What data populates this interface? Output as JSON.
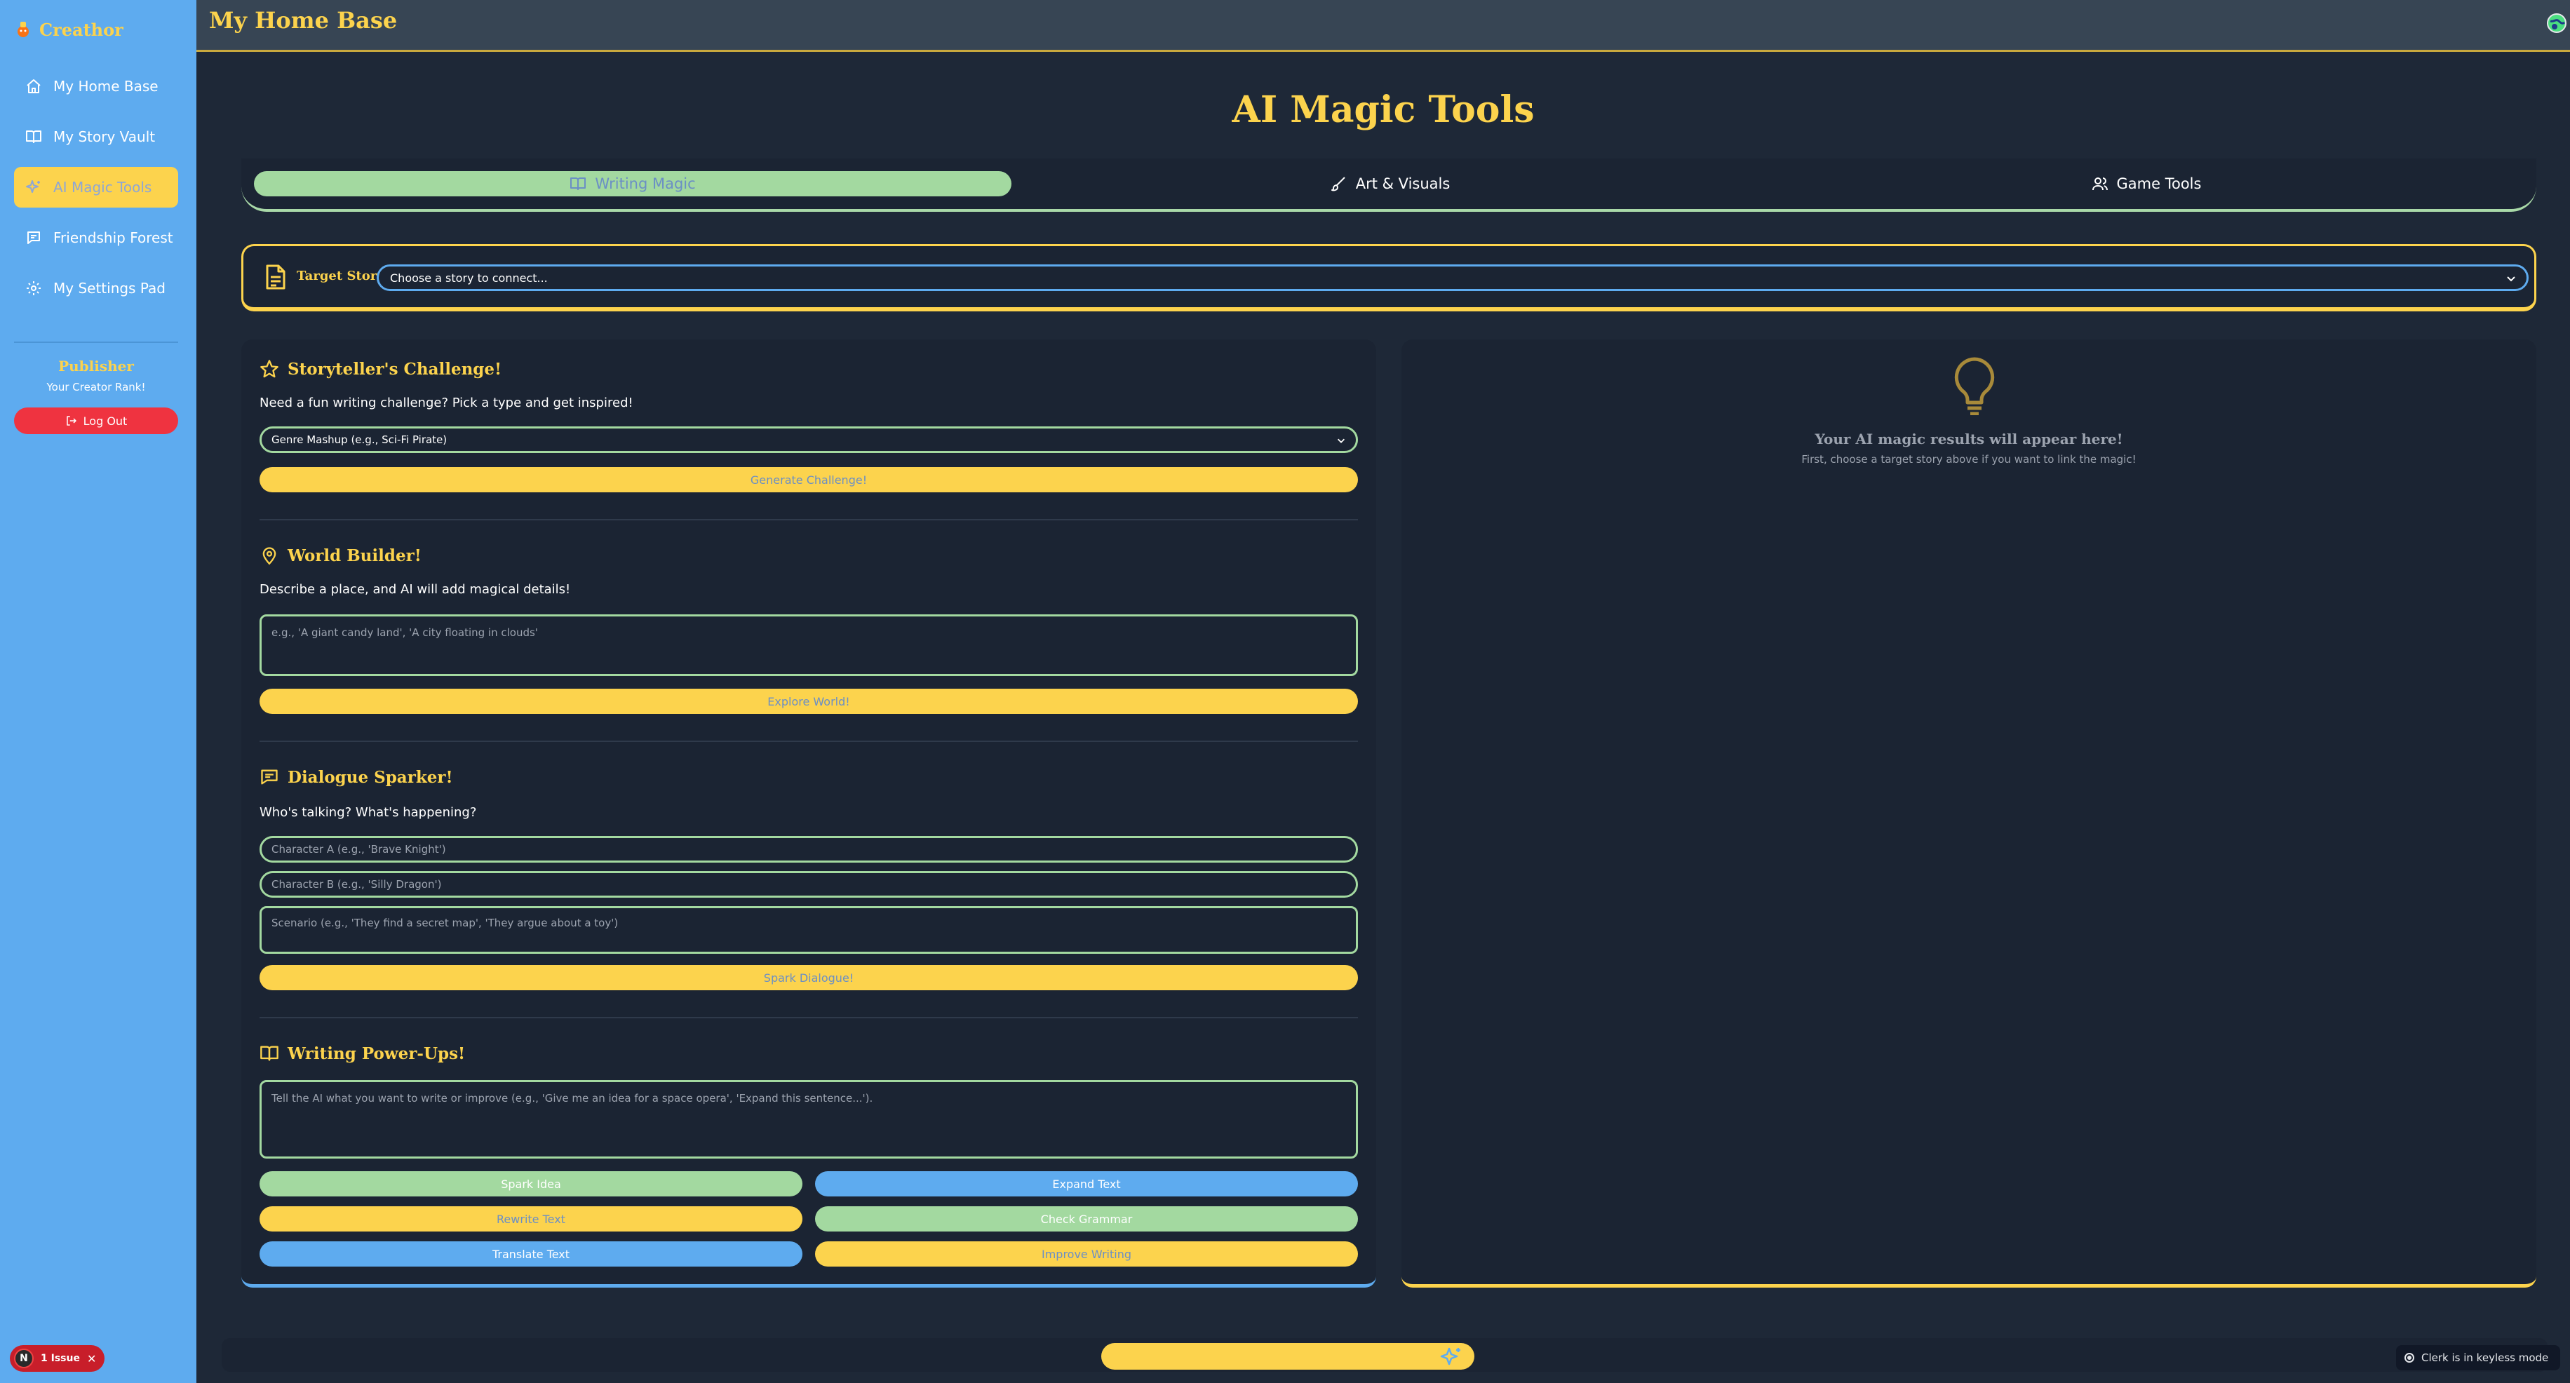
{
  "sidebar": {
    "brand": "Creathor",
    "items": [
      {
        "label": "My Home Base",
        "icon": "home-icon"
      },
      {
        "label": "My Story Vault",
        "icon": "book-icon"
      },
      {
        "label": "AI Magic Tools",
        "icon": "sparkles-icon",
        "active": true
      },
      {
        "label": "Friendship Forest",
        "icon": "chat-icon"
      },
      {
        "label": "My Settings Pad",
        "icon": "gear-icon"
      }
    ],
    "rank_title": "Publisher",
    "rank_sub": "Your Creator Rank!",
    "logout": "Log Out"
  },
  "header": {
    "title": "My Home Base"
  },
  "main": {
    "title": "AI Magic Tools",
    "tabs": [
      {
        "label": "Writing Magic",
        "active": true
      },
      {
        "label": "Art & Visuals"
      },
      {
        "label": "Game Tools"
      }
    ],
    "target": {
      "label": "Target Story:",
      "value": "Choose a story to connect..."
    },
    "challenge": {
      "title": "Storyteller's Challenge!",
      "desc": "Need a fun writing challenge? Pick a type and get inspired!",
      "selected": "Genre Mashup (e.g., Sci-Fi Pirate)",
      "button": "Generate Challenge!"
    },
    "world": {
      "title": "World Builder!",
      "desc": "Describe a place, and AI will add magical details!",
      "placeholder": "e.g., 'A giant candy land', 'A city floating in clouds'",
      "button": "Explore World!"
    },
    "dialogue": {
      "title": "Dialogue Sparker!",
      "desc": "Who's talking? What's happening?",
      "char_a": "Character A (e.g., 'Brave Knight')",
      "char_b": "Character B (e.g., 'Silly Dragon')",
      "scenario": "Scenario (e.g., 'They find a secret map', 'They argue about a toy')",
      "button": "Spark Dialogue!"
    },
    "powerups": {
      "title": "Writing Power-Ups!",
      "placeholder": "Tell the AI what you want to write or improve (e.g., 'Give me an idea for a space opera', 'Expand this sentence...').",
      "buttons": {
        "spark": "Spark Idea",
        "expand": "Expand Text",
        "rewrite": "Rewrite Text",
        "grammar": "Check Grammar",
        "translate": "Translate Text",
        "improve": "Improve Writing"
      }
    },
    "results": {
      "title": "Your AI magic results will appear here!",
      "sub": "First, choose a target story above if you want to link the magic!"
    }
  },
  "footer": {
    "issues": "1 Issue",
    "issues_avatar": "N",
    "clerk": "Clerk is in keyless mode"
  },
  "colors": {
    "sidebar": "#5eabef",
    "accent": "#fcd34d",
    "green": "#a3d9a0",
    "panel": "#1b2433",
    "background": "#1e2837",
    "danger": "#ef3340"
  }
}
